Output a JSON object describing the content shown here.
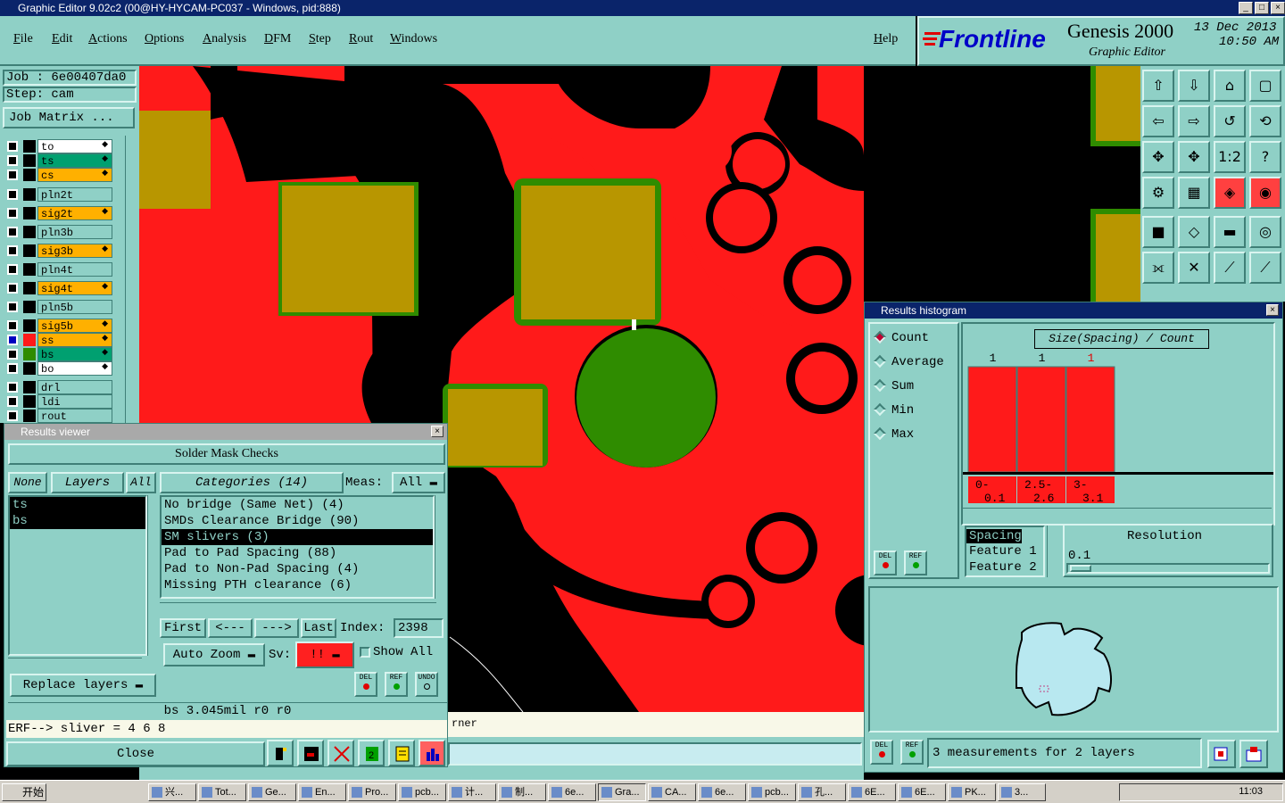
{
  "app": {
    "window_title": "Graphic Editor 9.02c2 (00@HY-HYCAM-PC037 - Windows, pid:888)",
    "brand_logo": "Frontline",
    "product": "Genesis 2000",
    "subtitle": "Graphic Editor",
    "date": "13 Dec 2013",
    "time": "10:50 AM"
  },
  "menu": [
    "File",
    "Edit",
    "Actions",
    "Options",
    "Analysis",
    "DFM",
    "Step",
    "Rout",
    "Windows"
  ],
  "help_label": "Help",
  "job": {
    "job_line": "Job : 6e00407da0",
    "step_line": "Step: cam",
    "matrix_button": "Job Matrix ..."
  },
  "layers": [
    {
      "name": "to",
      "color": "#ffffff",
      "marker": "◆"
    },
    {
      "name": "ts",
      "color": "#00a070",
      "marker": "◆"
    },
    {
      "name": "cs",
      "color": "#ffb000",
      "marker": "◆"
    },
    {
      "name": "pln2t",
      "color": "#8fd0c6",
      "marker": ""
    },
    {
      "name": "sig2t",
      "color": "#ffb000",
      "marker": "◆"
    },
    {
      "name": "pln3b",
      "color": "#8fd0c6",
      "marker": ""
    },
    {
      "name": "sig3b",
      "color": "#ffb000",
      "marker": "◆"
    },
    {
      "name": "pln4t",
      "color": "#8fd0c6",
      "marker": ""
    },
    {
      "name": "sig4t",
      "color": "#ffb000",
      "marker": "◆"
    },
    {
      "name": "pln5b",
      "color": "#8fd0c6",
      "marker": ""
    },
    {
      "name": "sig5b",
      "color": "#ffb000",
      "marker": "◆"
    },
    {
      "name": "ss",
      "color": "#ffb000",
      "marker": "◆"
    },
    {
      "name": "bs",
      "color": "#00a070",
      "marker": "◆"
    },
    {
      "name": "bo",
      "color": "#ffffff",
      "marker": "◆"
    },
    {
      "name": "drl",
      "color": "#8fd0c6",
      "marker": ""
    },
    {
      "name": "ldi",
      "color": "#8fd0c6",
      "marker": ""
    },
    {
      "name": "rout",
      "color": "#8fd0c6",
      "marker": ""
    }
  ],
  "results_viewer": {
    "title": "Results viewer",
    "header": "Solder Mask Checks",
    "none_btn": "None",
    "layers_btn": "Layers",
    "all_btn": "All",
    "layer_list": [
      "ts",
      "bs"
    ],
    "categories_btn": "Categories (14)",
    "meas_label": "Meas:",
    "meas_value": "All",
    "categories": [
      "No bridge (Same Net) (4)",
      "SMDs Clearance Bridge (90)",
      "SM slivers (3)",
      "Pad to Pad Spacing (88)",
      "Pad to Non-Pad Spacing (4)",
      "Missing PTH clearance (6)"
    ],
    "selected_category": 2,
    "first_btn": "First",
    "prev_btn": "<---",
    "next_btn": "--->",
    "last_btn": "Last",
    "index_label": "Index:",
    "index_value": "2398",
    "autozoom_btn": "Auto Zoom",
    "sv_label": "Sv:",
    "sv_value": "!!",
    "show_all": "Show All",
    "replace_btn": "Replace layers",
    "status_line": "bs 3.045mil  r0  r0",
    "erf_line": "ERF--> sliver = 4 6 8",
    "close_btn": "Close",
    "del_label": "DEL",
    "ref_label": "REF",
    "undo_label": "UNDO"
  },
  "histogram": {
    "title": "Results histogram",
    "modes": [
      "Count",
      "Average",
      "Sum",
      "Min",
      "Max"
    ],
    "selected_mode": 0,
    "caption": "Size(Spacing) / Count",
    "del_label": "DEL",
    "ref_label": "REF",
    "spacing_list": [
      "Spacing",
      "Feature 1",
      "Feature 2"
    ],
    "resolution_label": "Resolution",
    "resolution_value": "0.1",
    "measurements_text": "3 measurements for 2 layers"
  },
  "chart_data": {
    "type": "bar",
    "categories": [
      "0-\n0.1",
      "2.5-\n2.6",
      "3-\n3.1"
    ],
    "values": [
      1,
      1,
      1
    ],
    "title": "Size(Spacing) / Count"
  },
  "canvas": {
    "status_fragment": "rner"
  },
  "taskbar": {
    "start": "开始",
    "items": [
      "兴...",
      "Tot...",
      "Ge...",
      "En...",
      "Pro...",
      "pcb...",
      "计...",
      "制...",
      "6e...",
      "Gra...",
      "CA...",
      "6e...",
      "pcb...",
      "孔...",
      "6E...",
      "6E...",
      "PK...",
      "3..."
    ],
    "clock": "11:03"
  },
  "colors": {
    "panel": "#8fd0c6",
    "copper": "#ff1a1a",
    "pad": "#b89600",
    "mask": "#2f8c00"
  }
}
